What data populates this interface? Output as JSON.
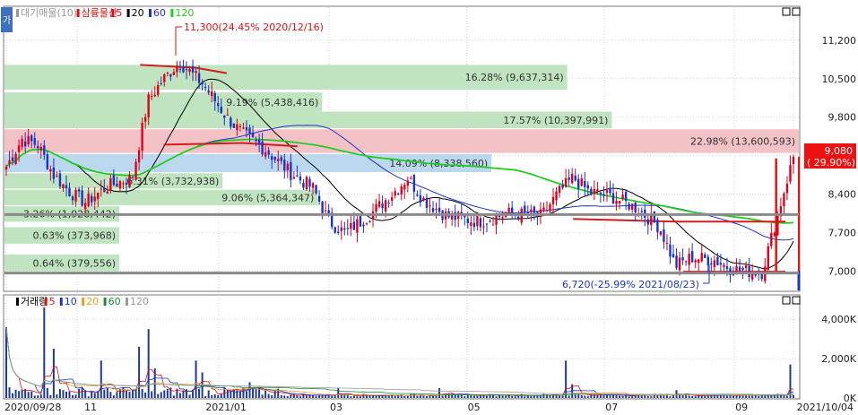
{
  "colors": {
    "up": "#e0001a",
    "down": "#1a34c8",
    "ma5": "#000000",
    "ma20": "#d21e1e",
    "ma60": "#2233cc",
    "ma120": "#22cc22",
    "vol_bar": "#1f3a93",
    "profile_green": "#bfe4bf",
    "profile_red": "#f3c2c6",
    "profile_blue": "#bcd8ee",
    "price_box": "#ee1111",
    "grid": "#d4d4d4",
    "frame": "#7a7a7a"
  },
  "price_panel": {
    "legend": [
      {
        "label": "대기매물(10)",
        "color": "#9a9a9a"
      },
      {
        "label": "삼륭물산",
        "color": "#dd1111"
      },
      {
        "label": "5",
        "color": "#dd1111"
      },
      {
        "label": "20",
        "color": "#000000"
      },
      {
        "label": "60",
        "color": "#2233cc"
      },
      {
        "label": "120",
        "color": "#22cc22"
      }
    ],
    "side_button": "가",
    "high_label": "11,300(24.45% 2020/12/16)",
    "low_label": "6,720(-25.99% 2021/08/23)",
    "current_price": "9,080",
    "current_change": "( 29.90%)",
    "y_ticks": [
      "11,200",
      "10,500",
      "9,800",
      "9,100",
      "8,400",
      "7,700",
      "7,000"
    ],
    "y_tick_values": [
      11200,
      10500,
      9800,
      9100,
      8400,
      7700,
      7000
    ]
  },
  "volume_panel": {
    "legend": [
      {
        "label": "거래량",
        "color": "#000000"
      },
      {
        "label": "5",
        "color": "#dd1111"
      },
      {
        "label": "10",
        "color": "#2233cc"
      },
      {
        "label": "20",
        "color": "#e0a020"
      },
      {
        "label": "60",
        "color": "#1a8a3a"
      },
      {
        "label": "120",
        "color": "#9a9a9a"
      }
    ],
    "y_ticks": [
      "4,000K",
      "2,000K",
      "0K"
    ],
    "y_tick_values": [
      4000,
      2000,
      0
    ]
  },
  "x_axis": {
    "labels": [
      "2020/09/28",
      "11",
      "2021/01",
      "03",
      "05",
      "07",
      "09",
      "2021/10/04"
    ]
  },
  "chart_data": {
    "type": "candlestick",
    "ylim": [
      6650,
      11800
    ],
    "volume_ylim": [
      0,
      4600
    ],
    "volume_profile": [
      {
        "price_from": 10300,
        "price_to": 10750,
        "label": "16.28% (9,637,314)",
        "pct": 16.28,
        "kind": "green"
      },
      {
        "price_from": 9900,
        "price_to": 10250,
        "label": "9.19% (5,438,416)",
        "pct": 9.19,
        "kind": "green"
      },
      {
        "price_from": 9600,
        "price_to": 9900,
        "label": "17.57% (10,397,991)",
        "pct": 17.57,
        "kind": "green"
      },
      {
        "price_from": 9150,
        "price_to": 9580,
        "label": "22.98% (13,600,593)",
        "pct": 22.98,
        "kind": "red"
      },
      {
        "price_from": 8800,
        "price_to": 9130,
        "label": "14.09% (8,338,560)",
        "pct": 14.09,
        "kind": "blue"
      },
      {
        "price_from": 8500,
        "price_to": 8780,
        "label": "6.31% (3,732,938)",
        "pct": 6.31,
        "kind": "green"
      },
      {
        "price_from": 8200,
        "price_to": 8480,
        "label": "9.06% (5,364,347)",
        "pct": 9.06,
        "kind": "green"
      },
      {
        "price_from": 7900,
        "price_to": 8180,
        "label": "3.26% (1,928,442)",
        "pct": 3.26,
        "kind": "green"
      },
      {
        "price_from": 7500,
        "price_to": 7800,
        "label": "0.63% (373,968)",
        "pct": 0.63,
        "kind": "green"
      },
      {
        "price_from": 7000,
        "price_to": 7300,
        "label": "0.64% (379,556)",
        "pct": 0.64,
        "kind": "green"
      }
    ],
    "support_lines": [
      8030,
      6965
    ],
    "key_points": [
      {
        "t": 0.0,
        "p": 8900
      },
      {
        "t": 0.02,
        "p": 9400
      },
      {
        "t": 0.04,
        "p": 9300
      },
      {
        "t": 0.06,
        "p": 8750
      },
      {
        "t": 0.08,
        "p": 8450
      },
      {
        "t": 0.1,
        "p": 8250
      },
      {
        "t": 0.13,
        "p": 8550
      },
      {
        "t": 0.16,
        "p": 8700
      },
      {
        "t": 0.18,
        "p": 10100
      },
      {
        "t": 0.2,
        "p": 10500
      },
      {
        "t": 0.22,
        "p": 10800
      },
      {
        "t": 0.25,
        "p": 10400
      },
      {
        "t": 0.28,
        "p": 9800
      },
      {
        "t": 0.3,
        "p": 9500
      },
      {
        "t": 0.33,
        "p": 9200
      },
      {
        "t": 0.36,
        "p": 8800
      },
      {
        "t": 0.39,
        "p": 8500
      },
      {
        "t": 0.41,
        "p": 7900
      },
      {
        "t": 0.43,
        "p": 7700
      },
      {
        "t": 0.46,
        "p": 8000
      },
      {
        "t": 0.49,
        "p": 8400
      },
      {
        "t": 0.51,
        "p": 8700
      },
      {
        "t": 0.53,
        "p": 8300
      },
      {
        "t": 0.56,
        "p": 8000
      },
      {
        "t": 0.6,
        "p": 7900
      },
      {
        "t": 0.64,
        "p": 8050
      },
      {
        "t": 0.68,
        "p": 8000
      },
      {
        "t": 0.7,
        "p": 8400
      },
      {
        "t": 0.72,
        "p": 8700
      },
      {
        "t": 0.74,
        "p": 8450
      },
      {
        "t": 0.77,
        "p": 8350
      },
      {
        "t": 0.8,
        "p": 8150
      },
      {
        "t": 0.83,
        "p": 7800
      },
      {
        "t": 0.85,
        "p": 7100
      },
      {
        "t": 0.87,
        "p": 7250
      },
      {
        "t": 0.9,
        "p": 7200
      },
      {
        "t": 0.92,
        "p": 7050
      },
      {
        "t": 0.94,
        "p": 7000
      },
      {
        "t": 0.96,
        "p": 6980
      },
      {
        "t": 1.0,
        "p": 9080
      }
    ],
    "volume_spikes": [
      {
        "t": 0.0,
        "v": 3600
      },
      {
        "t": 0.05,
        "v": 4600
      },
      {
        "t": 0.06,
        "v": 2500
      },
      {
        "t": 0.12,
        "v": 1900
      },
      {
        "t": 0.17,
        "v": 2600
      },
      {
        "t": 0.18,
        "v": 3500
      },
      {
        "t": 0.19,
        "v": 1500
      },
      {
        "t": 0.24,
        "v": 1900
      },
      {
        "t": 0.25,
        "v": 1300
      },
      {
        "t": 0.31,
        "v": 800
      },
      {
        "t": 0.42,
        "v": 500
      },
      {
        "t": 0.55,
        "v": 500
      },
      {
        "t": 0.71,
        "v": 1900
      },
      {
        "t": 0.72,
        "v": 700
      },
      {
        "t": 0.85,
        "v": 400
      },
      {
        "t": 0.995,
        "v": 1700
      }
    ]
  }
}
